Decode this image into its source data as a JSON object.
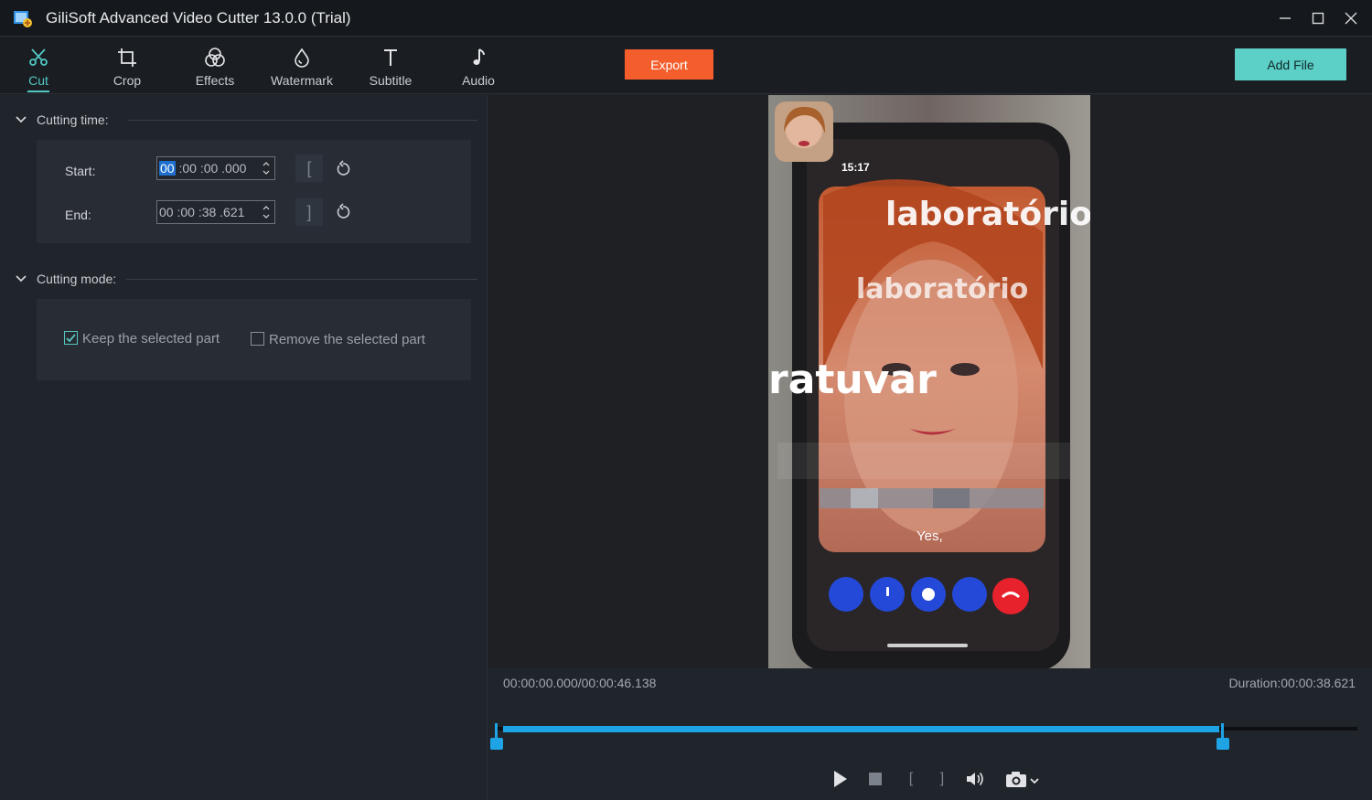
{
  "window": {
    "title": "GiliSoft Advanced Video Cutter 13.0.0 (Trial)"
  },
  "toolbar": {
    "tools": [
      {
        "label": "Cut",
        "icon": "scissors-icon"
      },
      {
        "label": "Crop",
        "icon": "crop-icon"
      },
      {
        "label": "Effects",
        "icon": "effects-icon"
      },
      {
        "label": "Watermark",
        "icon": "droplet-icon"
      },
      {
        "label": "Subtitle",
        "icon": "text-icon"
      },
      {
        "label": "Audio",
        "icon": "music-note-icon"
      }
    ],
    "active_tool": "Cut",
    "export_label": "Export",
    "add_file_label": "Add File"
  },
  "cutting_time": {
    "title": "Cutting time:",
    "start_label": "Start:",
    "start_selected": "00",
    "start_rest": " :00 :00 .000",
    "end_label": "End:",
    "end_value": "00 :00 :38 .621",
    "start_bracket": "[",
    "end_bracket": "]"
  },
  "cutting_mode": {
    "title": "Cutting mode:",
    "keep_label": "Keep the selected part",
    "keep_checked": true,
    "remove_label": "Remove the selected part",
    "remove_checked": false
  },
  "player": {
    "position": "00:00:00.000",
    "separator": "/",
    "total": "00:00:46.138",
    "duration_label": "Duration:",
    "duration": "00:00:38.621",
    "selection_start_fraction": 0.0,
    "selection_end_fraction": 0.837,
    "mark_in": "[",
    "mark_out": "]"
  },
  "video_overlay": {
    "phone_time": "15:17",
    "words": [
      "laboratório",
      "laboratório",
      "ratuvar",
      "Yes,"
    ]
  },
  "colors": {
    "accent_teal": "#51c8c4",
    "export_orange": "#f35e2c",
    "add_file_teal": "#5ccfc6",
    "timeline_blue": "#1ea3e4"
  }
}
